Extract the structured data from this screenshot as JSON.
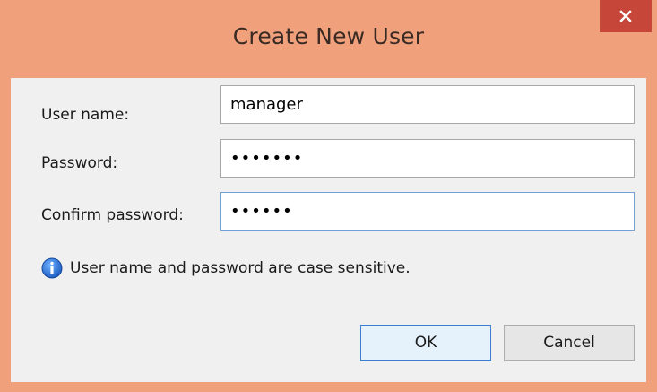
{
  "window": {
    "title": "Create New User",
    "close_icon": "close-icon",
    "accent_color": "#f0a17c",
    "close_color": "#c7463a"
  },
  "form": {
    "username_label": "User name:",
    "username_value": "manager",
    "password_label": "Password:",
    "password_value": "•••••••",
    "confirm_label": "Confirm password:",
    "confirm_value": "••••••"
  },
  "info": {
    "icon": "info-icon",
    "text": "User name and password are case sensitive."
  },
  "buttons": {
    "ok_label": "OK",
    "cancel_label": "Cancel"
  }
}
